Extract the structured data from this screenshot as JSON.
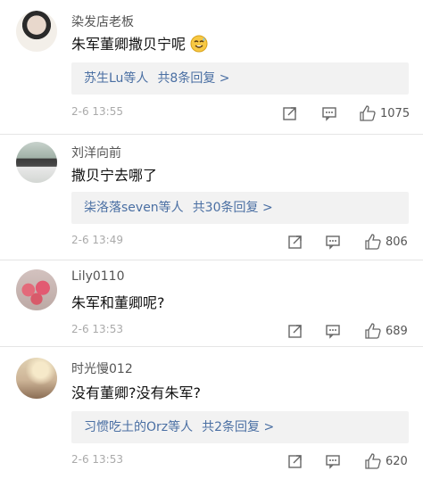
{
  "comments": [
    {
      "username": "染发店老板",
      "text": "朱军董卿撒贝宁呢",
      "emoji": "sweat-smile-emoji",
      "replies_users": "苏生Lu等人",
      "replies_count": "共8条回复 >",
      "time": "2-6 13:55",
      "likes": "1075"
    },
    {
      "username": "刘洋向前",
      "text": "撒贝宁去哪了",
      "replies_users": "柒洛落seven等人",
      "replies_count": "共30条回复 >",
      "time": "2-6 13:49",
      "likes": "806"
    },
    {
      "username": "Lily0110",
      "text": "朱军和董卿呢?",
      "time": "2-6 13:53",
      "likes": "689"
    },
    {
      "username": "时光慢012",
      "text": "没有董卿?没有朱军?",
      "replies_users": "习惯吃土的Orz等人",
      "replies_count": "共2条回复 >",
      "time": "2-6 13:53",
      "likes": "620"
    }
  ],
  "icons": {
    "share": "share-icon",
    "comment": "comment-icon",
    "like": "thumbs-up-icon"
  },
  "colors": {
    "link_blue": "#4a6fa3",
    "reply_bg": "#f2f2f2",
    "time_gray": "#aaaaaa"
  }
}
